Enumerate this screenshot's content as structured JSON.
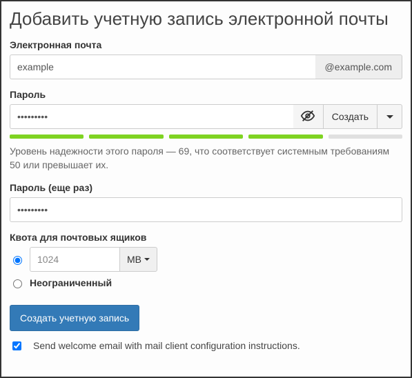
{
  "title": "Добавить учетную запись электронной почты",
  "email": {
    "label": "Электронная почта",
    "value": "example",
    "domain": "@example.com"
  },
  "password": {
    "label": "Пароль",
    "value": "•••••••••",
    "generate_label": "Создать",
    "strength_segments_on": 4,
    "strength_text": "Уровень надежности этого пароля — 69, что соответствует системным требованиям 50 или превышает их."
  },
  "password_confirm": {
    "label": "Пароль (еще раз)",
    "value": "•••••••••"
  },
  "quota": {
    "label": "Квота для почтовых ящиков",
    "value": "1024",
    "unit": "MB",
    "unlimited_label": "Неограниченный"
  },
  "submit_label": "Создать учетную запись",
  "welcome_checkbox_label": "Send welcome email with mail client configuration instructions."
}
